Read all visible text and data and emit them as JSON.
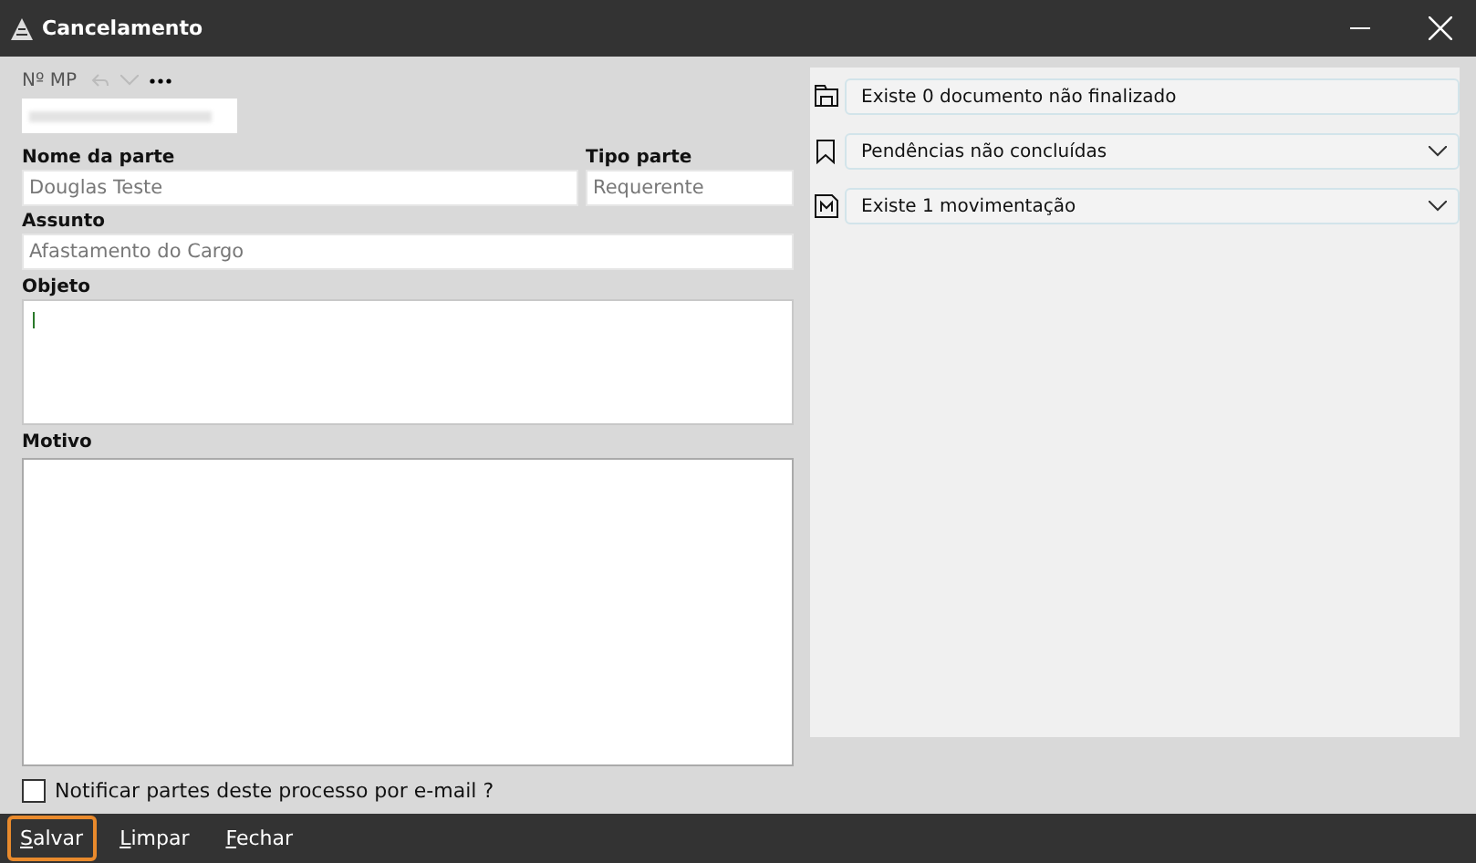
{
  "window": {
    "title": "Cancelamento"
  },
  "mp": {
    "label": "Nº MP",
    "blurred": true
  },
  "fields": [
    {
      "label": "Nome da parte",
      "value": "Douglas Teste"
    },
    {
      "label": "Tipo parte",
      "value": "Requerente"
    },
    {
      "label": "Assunto",
      "value": "Afastamento do Cargo"
    }
  ],
  "objeto": {
    "label": "Objeto",
    "focused": true
  },
  "motivo": {
    "label": "Motivo"
  },
  "notify": {
    "label": "Notificar partes deste processo por e-mail ?",
    "checked": false
  },
  "panel_items": [
    {
      "kind": "document",
      "text": "Existe 0 documento não finalizado",
      "expandable": false
    },
    {
      "kind": "bookmark",
      "text": "Pendências não concluídas",
      "expandable": true
    },
    {
      "kind": "movement",
      "text": "Existe 1 movimentação",
      "expandable": true
    }
  ],
  "buttons": [
    {
      "label": "Salvar",
      "focused": true
    },
    {
      "label": "Limpar",
      "focused": false
    },
    {
      "label": "Fechar",
      "focused": false
    }
  ]
}
